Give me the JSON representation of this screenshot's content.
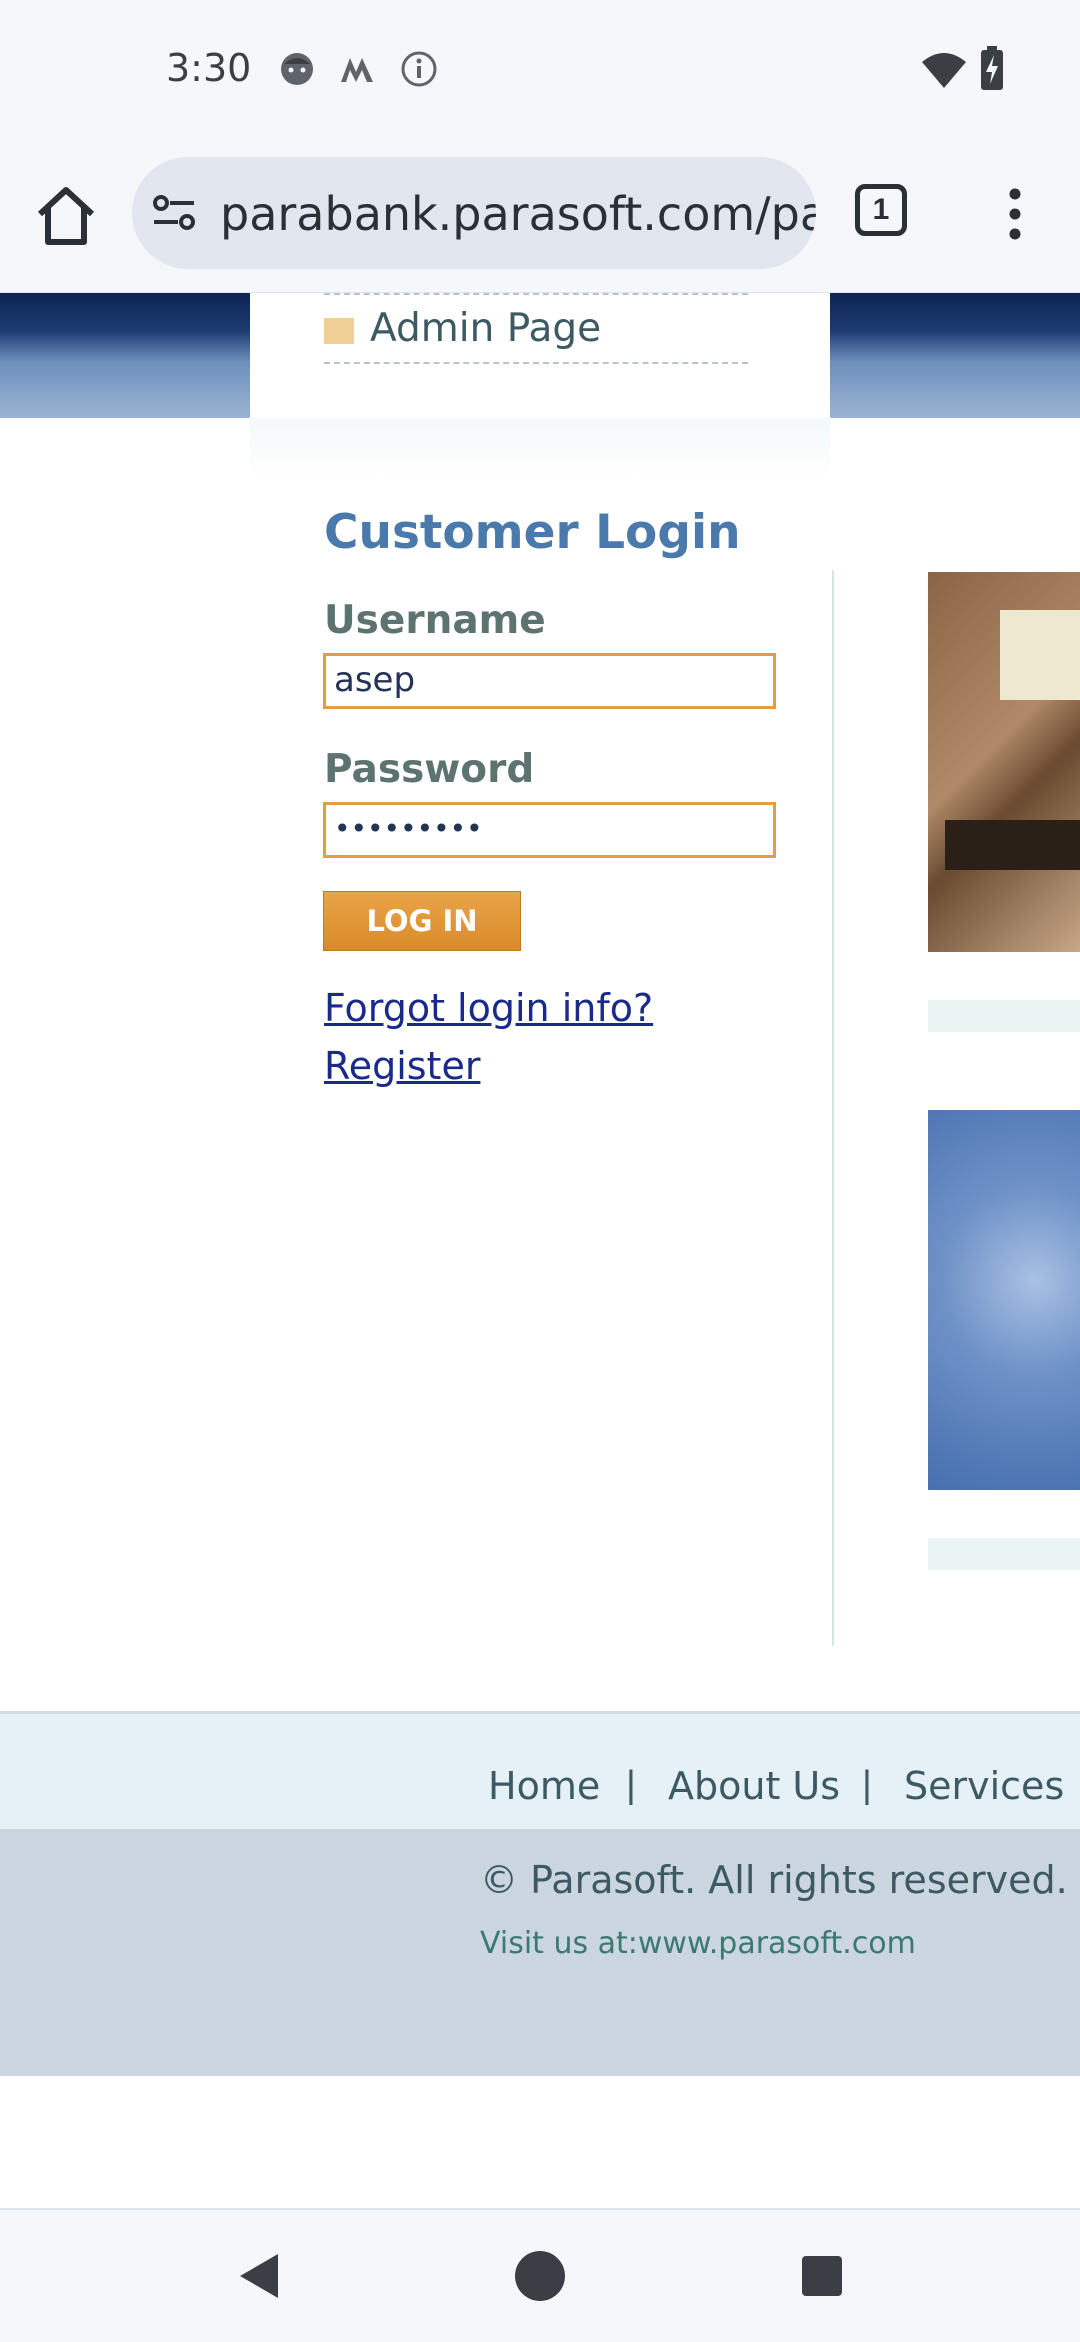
{
  "status_bar": {
    "time": "3:30",
    "icons": [
      "face-icon",
      "m-logo-icon",
      "info-icon",
      "wifi-icon",
      "battery-charging-icon"
    ]
  },
  "browser": {
    "url": "parabank.parasoft.com/parabank",
    "tab_count": "1",
    "icons": [
      "home-icon",
      "site-info-icon",
      "tabs-icon",
      "more-vert-icon"
    ]
  },
  "header": {
    "admin_link": "Admin Page"
  },
  "login": {
    "title": "Customer Login",
    "username_label": "Username",
    "username_value": "asep",
    "password_label": "Password",
    "password_value": "•••••••••",
    "button_label": "LOG IN",
    "forgot_link": "Forgot login info?",
    "register_link": "Register"
  },
  "footer": {
    "nav": [
      "Home",
      "About Us",
      "Services"
    ],
    "separator": "|",
    "copyright": "© Parasoft. All rights reserved.",
    "visit": "Visit us at:www.parasoft.com"
  },
  "colors": {
    "accent": "#4a79ab",
    "button": "#e09a3c",
    "header_dark": "#0d2451"
  }
}
